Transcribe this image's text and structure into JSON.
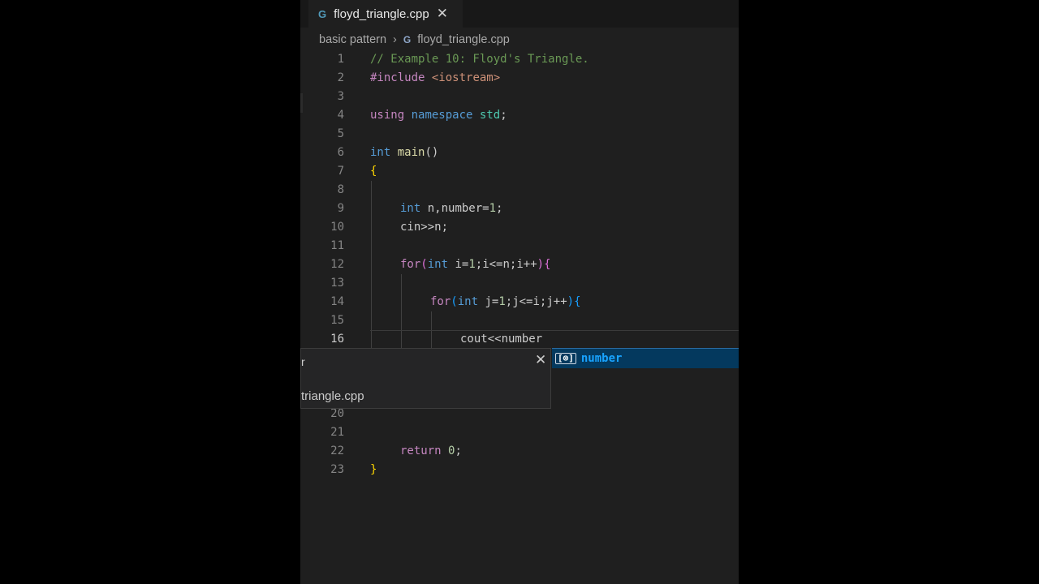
{
  "tab": {
    "icon": "cpp-file-icon",
    "filename": "floyd_triangle.cpp",
    "close": "✕"
  },
  "breadcrumb": {
    "folder": "basic pattern",
    "separator": "›",
    "file": "floyd_triangle.cpp"
  },
  "editor": {
    "active_line": 16,
    "lines": [
      {
        "n": "1"
      },
      {
        "n": "2"
      },
      {
        "n": "3"
      },
      {
        "n": "4"
      },
      {
        "n": "5"
      },
      {
        "n": "6"
      },
      {
        "n": "7"
      },
      {
        "n": "8"
      },
      {
        "n": "9"
      },
      {
        "n": "10"
      },
      {
        "n": "11"
      },
      {
        "n": "12"
      },
      {
        "n": "13"
      },
      {
        "n": "14"
      },
      {
        "n": "15"
      },
      {
        "n": "16"
      },
      {
        "n": "20"
      },
      {
        "n": "21"
      },
      {
        "n": "22"
      },
      {
        "n": "23"
      }
    ],
    "tokens": {
      "l1_comment": "// Example 10: Floyd's Triangle.",
      "l2_directive": "#include",
      "l2_header": "<iostream>",
      "l4_using": "using",
      "l4_namespace": "namespace",
      "l4_std": "std",
      "l4_semi": ";",
      "l6_int": "int",
      "l6_main": "main",
      "l6_parens": "()",
      "l7_brace": "{",
      "l9_int": "int",
      "l9_rest1": " n,number=",
      "l9_one": "1",
      "l9_semi": ";",
      "l10_text": "cin>>n;",
      "l12_for": "for",
      "l12_paren_open": "(",
      "l12_int": "int",
      "l12_mid1": " i=",
      "l12_one": "1",
      "l12_mid2": ";i<=n;i++",
      "l12_paren_close": ")",
      "l12_brace": "{",
      "l14_for": "for",
      "l14_paren_open": "(",
      "l14_int": "int",
      "l14_mid1": " j=",
      "l14_one": "1",
      "l14_mid2": ";j<=i;j++",
      "l14_paren_close": ")",
      "l14_brace": "{",
      "l16_text": "cout<<number",
      "l22_return": "return",
      "l22_zero": "0",
      "l22_semi": ";",
      "l23_brace": "}"
    }
  },
  "suggest": {
    "icon": "variable-icon",
    "icon_glyph": "[⊗]",
    "item": "number"
  },
  "peek": {
    "title": "r",
    "close": "✕",
    "file": "triangle.cpp"
  }
}
